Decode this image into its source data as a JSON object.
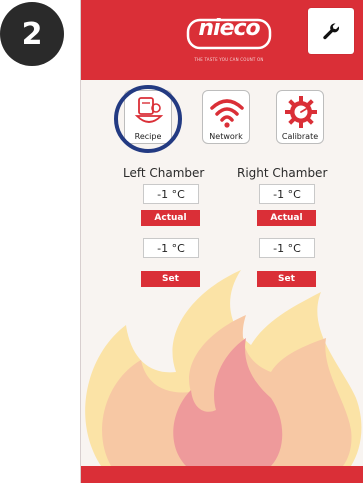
{
  "step_number": "2",
  "header": {
    "logo_text": "nieco",
    "tagline": "THE TASTE YOU CAN COUNT ON"
  },
  "nav": {
    "recipe_label": "Recipe",
    "network_label": "Network",
    "calibrate_label": "Calibrate"
  },
  "left_chamber": {
    "title": "Left Chamber",
    "actual_value": "-1 °C",
    "actual_label": "Actual",
    "set_value": "-1 °C",
    "set_label": "Set"
  },
  "right_chamber": {
    "title": "Right Chamber",
    "actual_value": "-1 °C",
    "actual_label": "Actual",
    "set_value": "-1 °C",
    "set_label": "Set"
  },
  "colors": {
    "brand_red": "#da2f37",
    "highlight_navy": "#233a82",
    "flame_yellow": "#fbe3a6",
    "flame_orange": "#f7c8a4",
    "flame_pink": "#ee9a9b"
  },
  "icons": [
    "settings-wrench-icon",
    "recipe-icon",
    "wifi-icon",
    "calibrate-gear-icon"
  ]
}
